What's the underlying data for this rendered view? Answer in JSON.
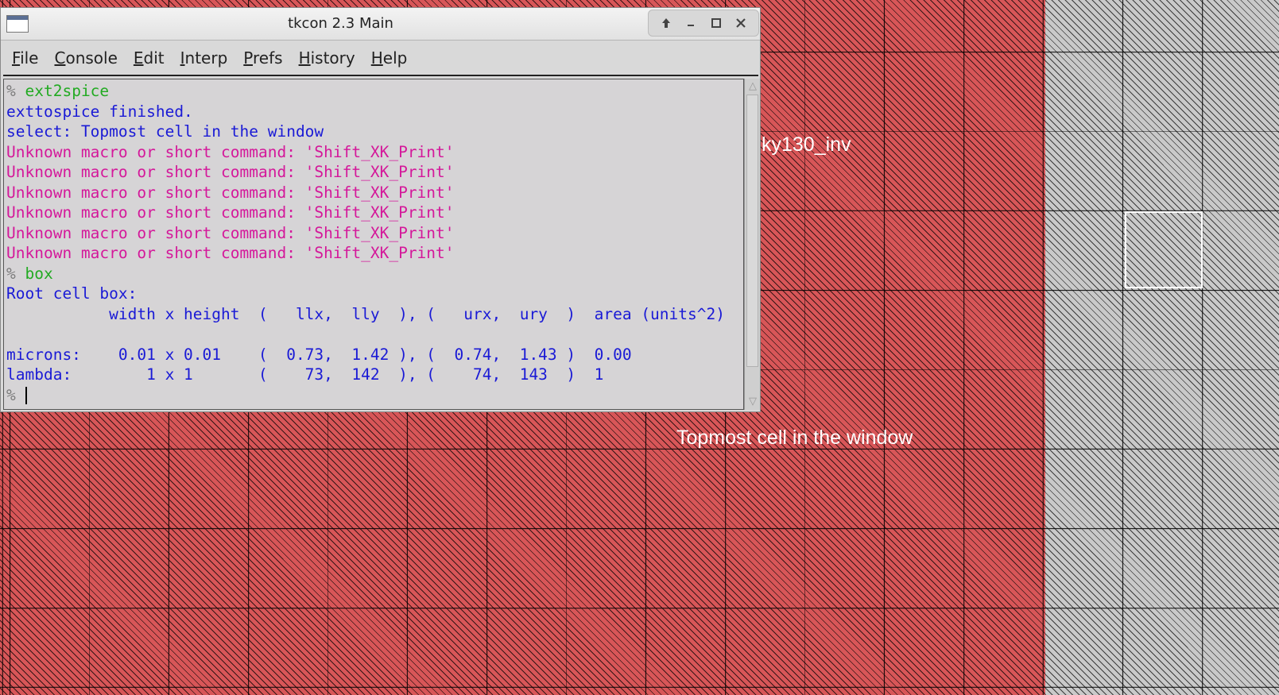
{
  "canvas": {
    "cell_name_label": "ky130_inv",
    "cell_caption": "Topmost cell in the window",
    "colors": {
      "layer_red": "#d85658",
      "layer_grey": "#c9c9c9"
    }
  },
  "window": {
    "title": "tkcon 2.3 Main",
    "buttons": {
      "maximize_up": "🡅",
      "minimize": "–",
      "restore": "❐",
      "close": "✕"
    },
    "menu": [
      {
        "first": "F",
        "rest": "ile"
      },
      {
        "first": "C",
        "rest": "onsole"
      },
      {
        "first": "E",
        "rest": "dit"
      },
      {
        "first": "I",
        "rest": "nterp"
      },
      {
        "first": "P",
        "rest": "refs"
      },
      {
        "first": "H",
        "rest": "istory"
      },
      {
        "first": "H",
        "rest": "elp"
      }
    ]
  },
  "console": {
    "prompt": "%",
    "lines": [
      {
        "type": "cmd",
        "text": "ext2spice"
      },
      {
        "type": "out",
        "text": "exttospice finished."
      },
      {
        "type": "out",
        "text": "select: Topmost cell in the window"
      },
      {
        "type": "err",
        "text": "Unknown macro or short command: 'Shift_XK_Print'"
      },
      {
        "type": "err",
        "text": "Unknown macro or short command: 'Shift_XK_Print'"
      },
      {
        "type": "err",
        "text": "Unknown macro or short command: 'Shift_XK_Print'"
      },
      {
        "type": "err",
        "text": "Unknown macro or short command: 'Shift_XK_Print'"
      },
      {
        "type": "err",
        "text": "Unknown macro or short command: 'Shift_XK_Print'"
      },
      {
        "type": "err",
        "text": "Unknown macro or short command: 'Shift_XK_Print'"
      },
      {
        "type": "cmd",
        "text": "box"
      },
      {
        "type": "out",
        "text": "Root cell box:"
      },
      {
        "type": "out",
        "text": "           width x height  (   llx,  lly  ), (   urx,  ury  )  area (units^2)"
      },
      {
        "type": "out",
        "text": ""
      },
      {
        "type": "out",
        "text": "microns:    0.01 x 0.01    (  0.73,  1.42 ), (  0.74,  1.43 )  0.00"
      },
      {
        "type": "out",
        "text": "lambda:        1 x 1       (    73,  142  ), (    74,  143  )  1"
      },
      {
        "type": "input",
        "text": ""
      }
    ]
  }
}
